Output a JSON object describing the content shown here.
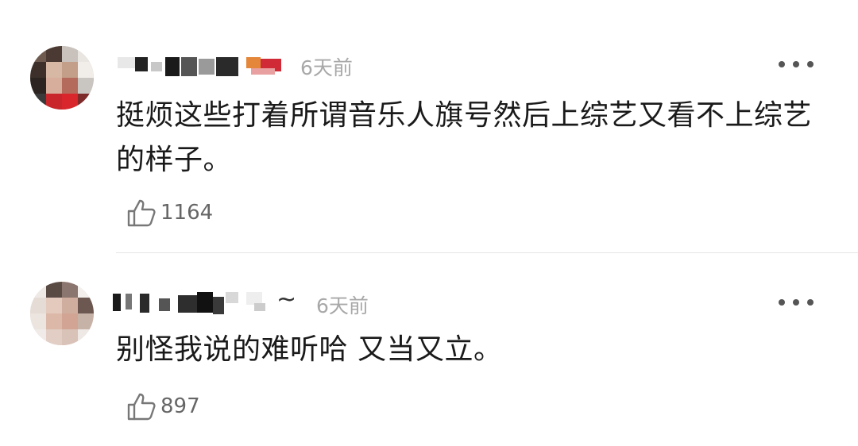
{
  "comments": [
    {
      "time": "6天前",
      "text": "挺烦这些打着所谓音乐人旗号然后上综艺又看不上综艺的样子。",
      "likes": "1164",
      "username_suffix": ""
    },
    {
      "time": "6天前",
      "text": "别怪我说的难听哈 又当又立。",
      "likes": "897",
      "username_suffix": "~"
    }
  ],
  "icons": {
    "like": "thumbs-up-icon",
    "more": "more-dots-icon"
  },
  "colors": {
    "text": "#1a1a1a",
    "meta": "#a8a8a8",
    "like_count": "#666666",
    "divider": "#e6e6e6"
  }
}
